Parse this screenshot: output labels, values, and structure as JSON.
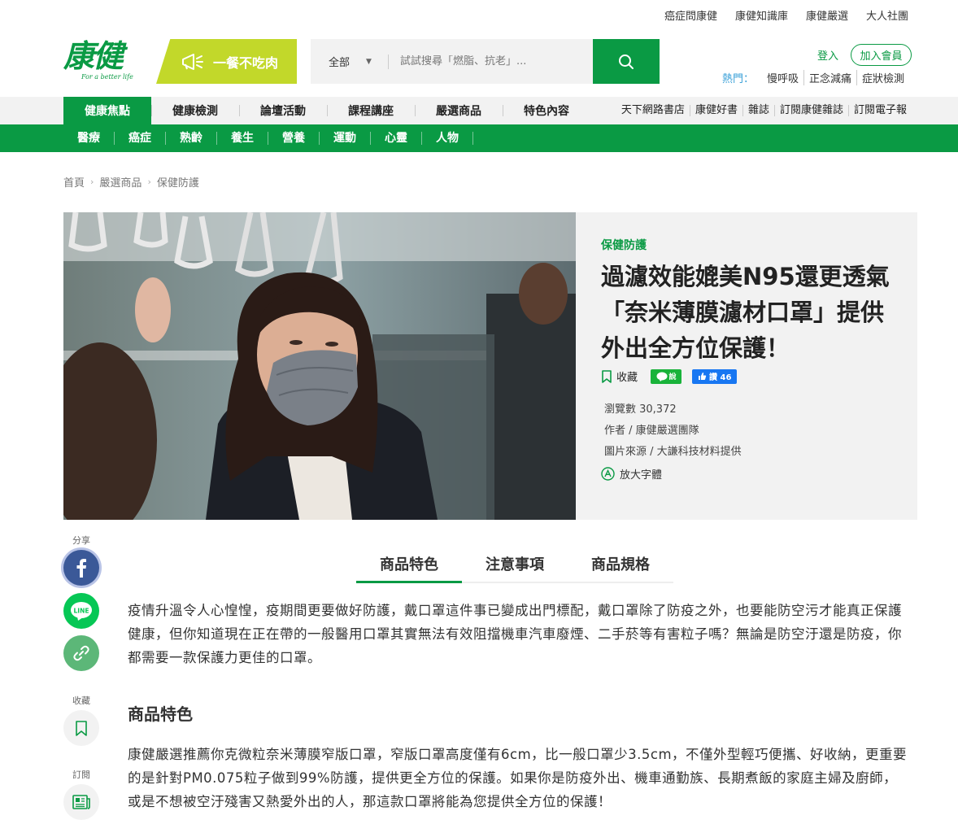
{
  "toplinks": [
    "癌症問康健",
    "康健知識庫",
    "康健嚴選",
    "大人社團"
  ],
  "logo": {
    "text": "康健",
    "sub": "For a better life"
  },
  "banner": {
    "label": "一餐不吃肉"
  },
  "search": {
    "category": "全部",
    "placeholder": "試試搜尋「燃脂、抗老」..."
  },
  "account": {
    "login": "登入",
    "join": "加入會員"
  },
  "hot": {
    "label": "熱門：",
    "items": [
      "慢呼吸",
      "正念減痛",
      "症狀檢測"
    ]
  },
  "nav_primary": [
    "健康焦點",
    "健康檢測",
    "論壇活動",
    "課程講座",
    "嚴選商品",
    "特色內容"
  ],
  "nav_right": [
    "天下網路書店",
    "康健好書",
    "雜誌",
    "訂閱康健雜誌",
    "訂閱電子報"
  ],
  "nav_secondary": [
    "醫療",
    "癌症",
    "熟齡",
    "養生",
    "營養",
    "運動",
    "心靈",
    "人物"
  ],
  "breadcrumb": [
    "首頁",
    "嚴選商品",
    "保健防護"
  ],
  "article": {
    "category": "保健防護",
    "title": "過濾效能媲美N95還更透氣「奈米薄膜濾材口罩」提供外出全方位保護！",
    "bookmark": "收藏",
    "line_label": "說",
    "fb_label": "讚 46",
    "views": "瀏覽數 30,372",
    "author": "作者 / 康健嚴選團隊",
    "photo_credit": "圖片來源 / 大謙科技材料提供",
    "font_size": "放大字體"
  },
  "sidebar": {
    "share": "分享",
    "collect": "收藏",
    "subscribe": "訂閱",
    "line_text": "LINE"
  },
  "tabs": [
    "商品特色",
    "注意事項",
    "商品規格"
  ],
  "body": {
    "intro": "疫情升溫令人心惶惶，疫期間更要做好防護，戴口罩這件事已變成出門標配，戴口罩除了防疫之外，也要能防空污才能真正保護健康，但你知道現在正在帶的一般醫用口罩其實無法有效阻擋機車汽車廢煙、二手菸等有害粒子嗎？無論是防空汙還是防疫，你都需要一款保護力更佳的口罩。",
    "heading": "商品特色",
    "feature": "康健嚴選推薦你克微粒奈米薄膜窄版口罩，窄版口罩高度僅有6cm，比一般口罩少3.5cm，不僅外型輕巧便攜、好收納，更重要的是針對PM0.075粒子做到99%防護，提供更全方位的保護。如果你是防疫外出、機車通勤族、長期煮飯的家庭主婦及廚師，或是不想被空汙殘害又熱愛外出的人，那這款口罩將能為您提供全方位的保護！"
  },
  "colors": {
    "brand_green": "#0a9a44",
    "banner_lime": "#c2d82a",
    "facebook": "#3b5998",
    "line": "#06c755"
  }
}
